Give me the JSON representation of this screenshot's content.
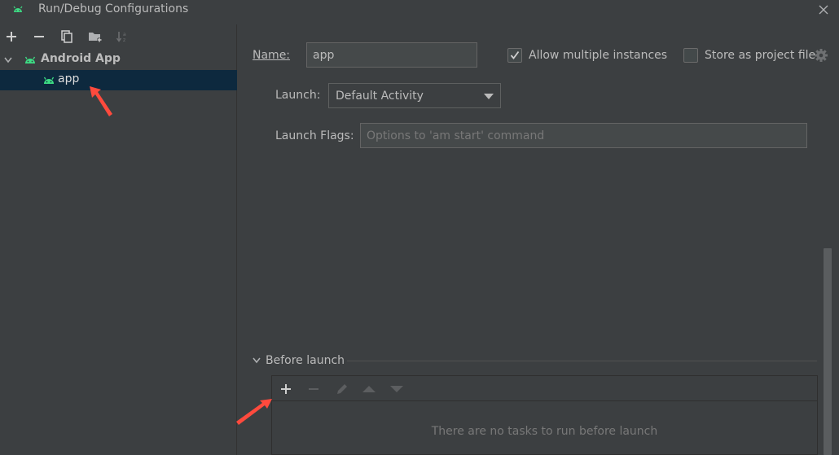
{
  "window": {
    "title": "Run/Debug Configurations"
  },
  "tree": {
    "group_label": "Android App",
    "item_label": "app"
  },
  "form": {
    "name_label": "Name:",
    "name_value": "app",
    "allow_multiple_label": "Allow multiple instances",
    "allow_multiple_checked": true,
    "store_project_label": "Store as project file",
    "store_project_checked": false,
    "launch_label": "Launch:",
    "launch_value": "Default Activity",
    "launch_flags_label": "Launch Flags:",
    "launch_flags_placeholder": "Options to 'am start' command"
  },
  "before_launch": {
    "title": "Before launch",
    "empty_text": "There are no tasks to run before launch"
  },
  "colors": {
    "android_green": "#3ddc84",
    "annotation_red": "#ff4a3d",
    "selected_bg": "#0d293e"
  }
}
